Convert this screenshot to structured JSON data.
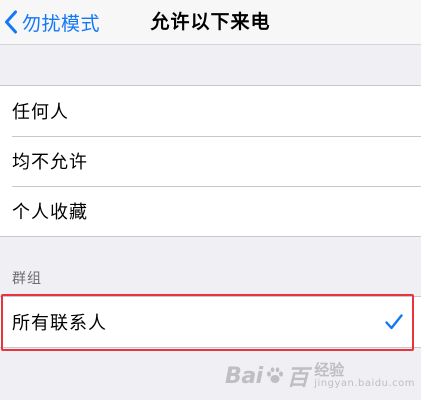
{
  "nav": {
    "back_label": "勿扰模式",
    "title": "允许以下来电",
    "back_icon": "chevron-left-icon"
  },
  "options": [
    {
      "label": "任何人",
      "selected": false
    },
    {
      "label": "均不允许",
      "selected": false
    },
    {
      "label": "个人收藏",
      "selected": false
    }
  ],
  "groups_section": {
    "header": "群组",
    "items": [
      {
        "label": "所有联系人",
        "selected": true
      }
    ]
  },
  "selected_icon": "checkmark-icon",
  "highlight_color": "#e8343a",
  "accent_color": "#1478f6",
  "watermark": {
    "brand_left": "Bai",
    "brand_right": "百",
    "sub_cn": "经验",
    "domain": "jingyan.baidu.com"
  }
}
